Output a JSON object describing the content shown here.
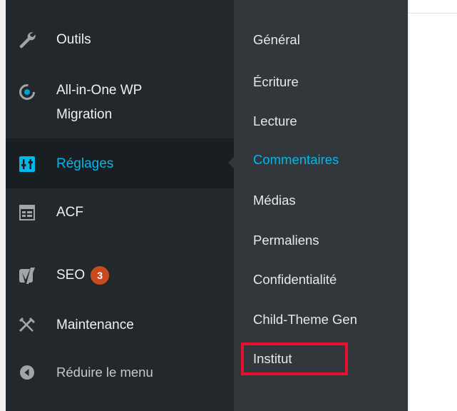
{
  "sidebar": {
    "items": [
      {
        "label": "Outils",
        "icon": "wrench-icon"
      },
      {
        "label": "All-in-One WP",
        "label_line2": "Migration",
        "icon": "migration-icon"
      },
      {
        "label": "Réglages",
        "icon": "settings-sliders-icon",
        "current": true
      },
      {
        "label": "ACF",
        "icon": "acf-table-icon"
      },
      {
        "label": "SEO",
        "icon": "yoast-icon",
        "badge": "3"
      },
      {
        "label": "Maintenance",
        "icon": "tools-cross-icon"
      },
      {
        "label": "Réduire le menu",
        "icon": "collapse-arrow-icon"
      }
    ]
  },
  "submenu": {
    "items": [
      {
        "label": "Général"
      },
      {
        "label": "Écriture"
      },
      {
        "label": "Lecture"
      },
      {
        "label": "Commentaires",
        "active": true
      },
      {
        "label": "Médias"
      },
      {
        "label": "Permaliens"
      },
      {
        "label": "Confidentialité"
      },
      {
        "label": "Child-Theme Gen"
      },
      {
        "label": "Institut",
        "highlighted": true
      }
    ]
  },
  "colors": {
    "sidebar_bg": "#23282d",
    "submenu_bg": "#32373c",
    "accent": "#00b9eb",
    "badge": "#ca4a1f",
    "highlight": "#e8112d"
  }
}
